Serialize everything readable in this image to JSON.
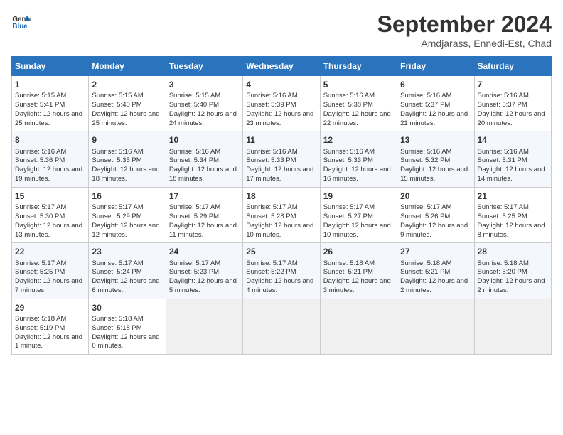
{
  "logo": {
    "line1": "General",
    "line2": "Blue"
  },
  "title": "September 2024",
  "subtitle": "Amdjarass, Ennedi-Est, Chad",
  "days_of_week": [
    "Sunday",
    "Monday",
    "Tuesday",
    "Wednesday",
    "Thursday",
    "Friday",
    "Saturday"
  ],
  "weeks": [
    [
      {
        "day": 1,
        "sunrise": "5:15 AM",
        "sunset": "5:41 PM",
        "daylight": "12 hours and 25 minutes."
      },
      {
        "day": 2,
        "sunrise": "5:15 AM",
        "sunset": "5:40 PM",
        "daylight": "12 hours and 25 minutes."
      },
      {
        "day": 3,
        "sunrise": "5:15 AM",
        "sunset": "5:40 PM",
        "daylight": "12 hours and 24 minutes."
      },
      {
        "day": 4,
        "sunrise": "5:16 AM",
        "sunset": "5:39 PM",
        "daylight": "12 hours and 23 minutes."
      },
      {
        "day": 5,
        "sunrise": "5:16 AM",
        "sunset": "5:38 PM",
        "daylight": "12 hours and 22 minutes."
      },
      {
        "day": 6,
        "sunrise": "5:16 AM",
        "sunset": "5:37 PM",
        "daylight": "12 hours and 21 minutes."
      },
      {
        "day": 7,
        "sunrise": "5:16 AM",
        "sunset": "5:37 PM",
        "daylight": "12 hours and 20 minutes."
      }
    ],
    [
      {
        "day": 8,
        "sunrise": "5:16 AM",
        "sunset": "5:36 PM",
        "daylight": "12 hours and 19 minutes."
      },
      {
        "day": 9,
        "sunrise": "5:16 AM",
        "sunset": "5:35 PM",
        "daylight": "12 hours and 18 minutes."
      },
      {
        "day": 10,
        "sunrise": "5:16 AM",
        "sunset": "5:34 PM",
        "daylight": "12 hours and 18 minutes."
      },
      {
        "day": 11,
        "sunrise": "5:16 AM",
        "sunset": "5:33 PM",
        "daylight": "12 hours and 17 minutes."
      },
      {
        "day": 12,
        "sunrise": "5:16 AM",
        "sunset": "5:33 PM",
        "daylight": "12 hours and 16 minutes."
      },
      {
        "day": 13,
        "sunrise": "5:16 AM",
        "sunset": "5:32 PM",
        "daylight": "12 hours and 15 minutes."
      },
      {
        "day": 14,
        "sunrise": "5:16 AM",
        "sunset": "5:31 PM",
        "daylight": "12 hours and 14 minutes."
      }
    ],
    [
      {
        "day": 15,
        "sunrise": "5:17 AM",
        "sunset": "5:30 PM",
        "daylight": "12 hours and 13 minutes."
      },
      {
        "day": 16,
        "sunrise": "5:17 AM",
        "sunset": "5:29 PM",
        "daylight": "12 hours and 12 minutes."
      },
      {
        "day": 17,
        "sunrise": "5:17 AM",
        "sunset": "5:29 PM",
        "daylight": "12 hours and 11 minutes."
      },
      {
        "day": 18,
        "sunrise": "5:17 AM",
        "sunset": "5:28 PM",
        "daylight": "12 hours and 10 minutes."
      },
      {
        "day": 19,
        "sunrise": "5:17 AM",
        "sunset": "5:27 PM",
        "daylight": "12 hours and 10 minutes."
      },
      {
        "day": 20,
        "sunrise": "5:17 AM",
        "sunset": "5:26 PM",
        "daylight": "12 hours and 9 minutes."
      },
      {
        "day": 21,
        "sunrise": "5:17 AM",
        "sunset": "5:25 PM",
        "daylight": "12 hours and 8 minutes."
      }
    ],
    [
      {
        "day": 22,
        "sunrise": "5:17 AM",
        "sunset": "5:25 PM",
        "daylight": "12 hours and 7 minutes."
      },
      {
        "day": 23,
        "sunrise": "5:17 AM",
        "sunset": "5:24 PM",
        "daylight": "12 hours and 6 minutes."
      },
      {
        "day": 24,
        "sunrise": "5:17 AM",
        "sunset": "5:23 PM",
        "daylight": "12 hours and 5 minutes."
      },
      {
        "day": 25,
        "sunrise": "5:17 AM",
        "sunset": "5:22 PM",
        "daylight": "12 hours and 4 minutes."
      },
      {
        "day": 26,
        "sunrise": "5:18 AM",
        "sunset": "5:21 PM",
        "daylight": "12 hours and 3 minutes."
      },
      {
        "day": 27,
        "sunrise": "5:18 AM",
        "sunset": "5:21 PM",
        "daylight": "12 hours and 2 minutes."
      },
      {
        "day": 28,
        "sunrise": "5:18 AM",
        "sunset": "5:20 PM",
        "daylight": "12 hours and 2 minutes."
      }
    ],
    [
      {
        "day": 29,
        "sunrise": "5:18 AM",
        "sunset": "5:19 PM",
        "daylight": "12 hours and 1 minute."
      },
      {
        "day": 30,
        "sunrise": "5:18 AM",
        "sunset": "5:18 PM",
        "daylight": "12 hours and 0 minutes."
      },
      null,
      null,
      null,
      null,
      null
    ]
  ]
}
